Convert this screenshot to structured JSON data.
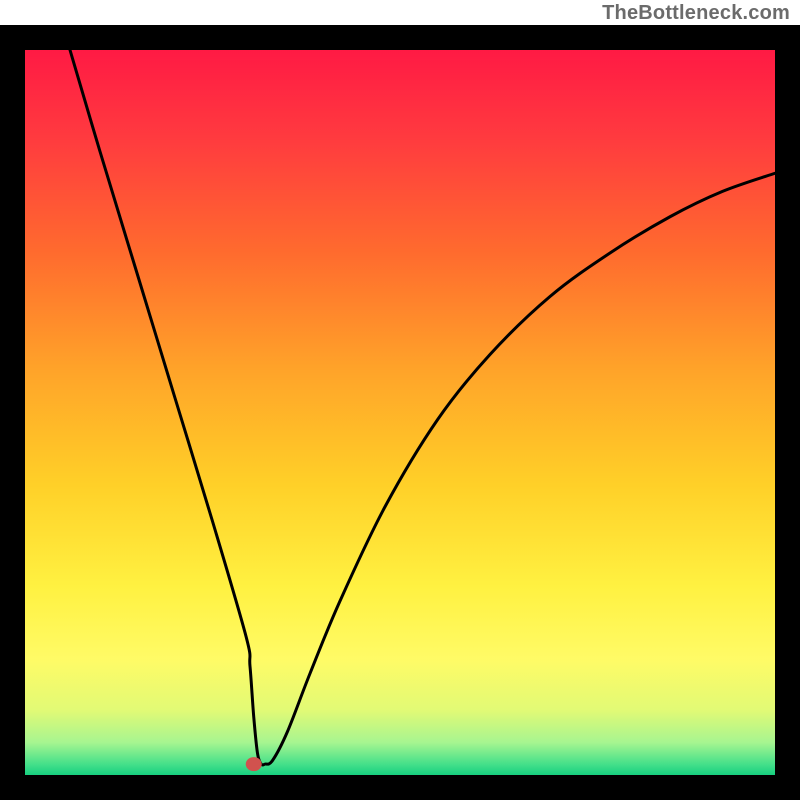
{
  "attribution": "TheBottleneck.com",
  "chart_data": {
    "type": "line",
    "title": "",
    "xlabel": "",
    "ylabel": "",
    "xlim": [
      0,
      100
    ],
    "ylim": [
      0,
      100
    ],
    "grid": false,
    "legend": false,
    "series": [
      {
        "name": "bottleneck-curve",
        "x": [
          6,
          10,
          15,
          20,
          25,
          29.5,
          30,
          30.5,
          31,
          31.5,
          32,
          33,
          35,
          38,
          42,
          48,
          55,
          62,
          70,
          78,
          86,
          93,
          100
        ],
        "values": [
          100,
          86,
          69,
          52,
          35,
          19,
          15,
          8,
          3,
          1.5,
          1.5,
          2,
          6,
          14,
          24,
          37,
          49,
          58,
          66,
          72,
          77,
          80.5,
          83
        ]
      }
    ],
    "marker": {
      "x": 30.5,
      "y": 1.5
    },
    "gradient_stops": [
      {
        "offset": 0.0,
        "color": "#ff1a44"
      },
      {
        "offset": 0.12,
        "color": "#ff3a3f"
      },
      {
        "offset": 0.28,
        "color": "#ff6b2e"
      },
      {
        "offset": 0.44,
        "color": "#ffa329"
      },
      {
        "offset": 0.6,
        "color": "#ffd028"
      },
      {
        "offset": 0.74,
        "color": "#fff141"
      },
      {
        "offset": 0.84,
        "color": "#fffb66"
      },
      {
        "offset": 0.91,
        "color": "#e2fa75"
      },
      {
        "offset": 0.955,
        "color": "#a7f590"
      },
      {
        "offset": 0.985,
        "color": "#45e08a"
      },
      {
        "offset": 1.0,
        "color": "#17cf80"
      }
    ],
    "frame_color": "#000000",
    "frame_thickness_px": 25
  }
}
